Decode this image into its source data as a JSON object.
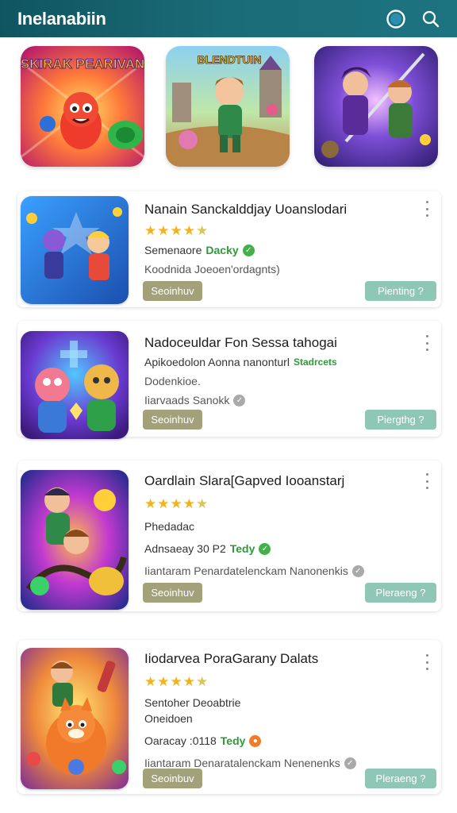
{
  "header": {
    "title": "Inelanabiin",
    "icons": [
      "profile-ring-icon",
      "search-icon"
    ],
    "colors": {
      "bar_start": "#0f5560",
      "bar_end": "#1c7480"
    }
  },
  "featured": [
    {
      "name": "featured-game-1",
      "art_text": "SKIRAK PEARIVAN"
    },
    {
      "name": "featured-game-2",
      "art_text": "BLENDTUIN"
    },
    {
      "name": "featured-game-3",
      "art_text": ""
    }
  ],
  "cards": [
    {
      "title": "Nanain Sanckalddjay Uoanslodari",
      "rating": 4.5,
      "line1": "Semenaore",
      "line1_green": "Dacky",
      "line1_badge": "green",
      "line2": "Koodnida Joeoen'ordagnts)",
      "left_button": "Seoinhuv",
      "right_button": "Pienting ?"
    },
    {
      "title": "Nadoceuldar Fon Sessa tahogai",
      "line1": "Apikoedolon Aonna nanonturl",
      "line1_green": "Stadrcets",
      "line2": "Dodenkioe.",
      "line3": "Iiarvaads Sanokk",
      "line3_badge": "grey",
      "left_button": "Seoinhuv",
      "right_button": "Piergthg ?"
    },
    {
      "title": "Oardlain Slara[Gapved Iooanstarj",
      "rating": 4.5,
      "line1": "Phedadac",
      "line2": "Adnsaeay 30 P2",
      "line2_green": "Tedy",
      "line2_badge": "green",
      "line3": "Iiantaram Penardatelenckam Nanonenkis",
      "line3_badge": "grey",
      "left_button": "Seoinhuv",
      "right_button": "Pleraeng ?"
    },
    {
      "title": "Iiodarvea PoraGarany Dalats",
      "rating": 4.5,
      "line1": "Sentoher Deoabtrie",
      "line2": "Oneidoen",
      "line3": "Oaracay :0118",
      "line3_green": "Tedy",
      "line3_badge": "orange",
      "line4": "Iiantaram Denaratalenckam Nenenenks",
      "line4_badge": "grey",
      "left_button": "Seoinbuv",
      "right_button": "Pleraeng ?"
    }
  ]
}
